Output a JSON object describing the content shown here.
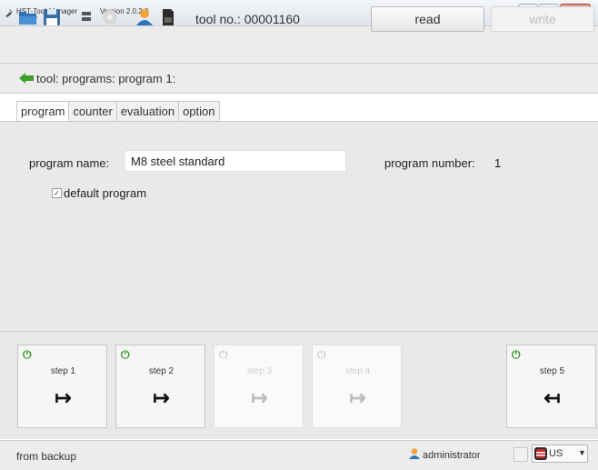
{
  "window": {
    "title": "HST-Tool-Manager",
    "version": "Version 2.0.2.0"
  },
  "toolbar": {
    "icons": [
      "folder-open-icon",
      "save-icon",
      "database-icon",
      "settings-icon",
      "user-icon",
      "sd-card-icon"
    ],
    "tool_no": "tool no.: 00001160",
    "read_label": "read",
    "write_label": "write"
  },
  "breadcrumb": {
    "text": "tool: programs: program 1:"
  },
  "tabs": [
    {
      "label": "program",
      "active": true
    },
    {
      "label": "counter",
      "active": false
    },
    {
      "label": "evaluation",
      "active": false
    },
    {
      "label": "option",
      "active": false
    }
  ],
  "program": {
    "name_label": "program name:",
    "name_value": "M8 steel standard",
    "number_label": "program number:",
    "number_value": "1",
    "default_checked": true,
    "default_label": "default program"
  },
  "steps": [
    {
      "label": "step 1",
      "enabled": true,
      "arrow": "in"
    },
    {
      "label": "step 2",
      "enabled": true,
      "arrow": "in"
    },
    {
      "label": "step 3",
      "enabled": false,
      "arrow": "in"
    },
    {
      "label": "step 4",
      "enabled": false,
      "arrow": "in"
    },
    {
      "label": "step 5",
      "enabled": true,
      "arrow": "out"
    }
  ],
  "status": {
    "source": "from backup",
    "user": "administrator",
    "language": "US"
  },
  "colors": {
    "accent_green": "#2f9a1e",
    "disabled_text": "#bdbdbd"
  }
}
